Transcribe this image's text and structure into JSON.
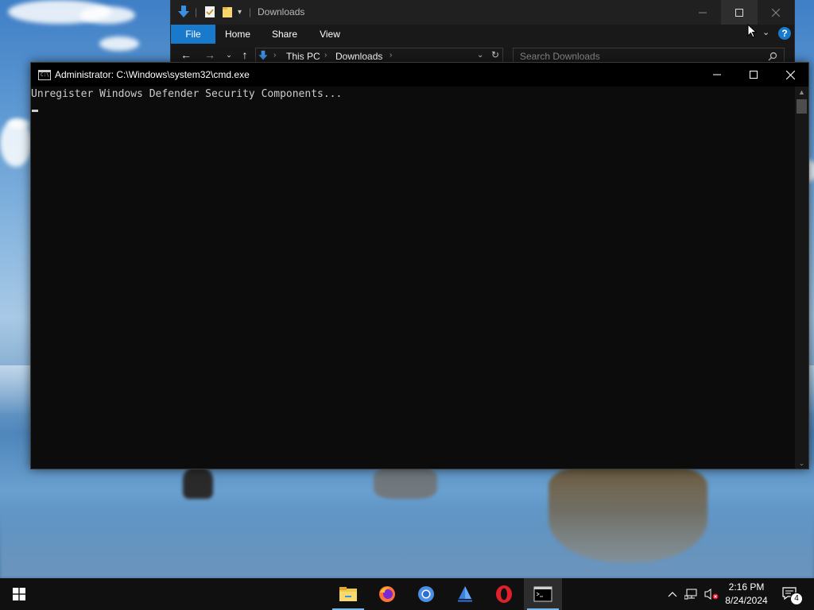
{
  "explorer": {
    "title": "Downloads",
    "tabs": [
      {
        "label": "File",
        "active": true
      },
      {
        "label": "Home"
      },
      {
        "label": "Share"
      },
      {
        "label": "View"
      }
    ],
    "breadcrumb": [
      "This PC",
      "Downloads"
    ],
    "search_placeholder": "Search Downloads",
    "help_glyph": "?",
    "accent_color": "#1979ca"
  },
  "cmd": {
    "title": "Administrator: C:\\Windows\\system32\\cmd.exe",
    "output_line": "Unregister Windows Defender Security Components...",
    "icon_text": "C:\\"
  },
  "taskbar": {
    "apps": [
      {
        "name": "file-explorer-icon",
        "running": true
      },
      {
        "name": "firefox-icon",
        "running": false
      },
      {
        "name": "chrome-icon",
        "running": false
      },
      {
        "name": "sailboat-app-icon",
        "running": false
      },
      {
        "name": "opera-icon",
        "running": false
      },
      {
        "name": "command-prompt-icon",
        "running": true,
        "active": true
      }
    ],
    "time": "2:16 PM",
    "date": "8/24/2024",
    "notification_count": "4"
  }
}
